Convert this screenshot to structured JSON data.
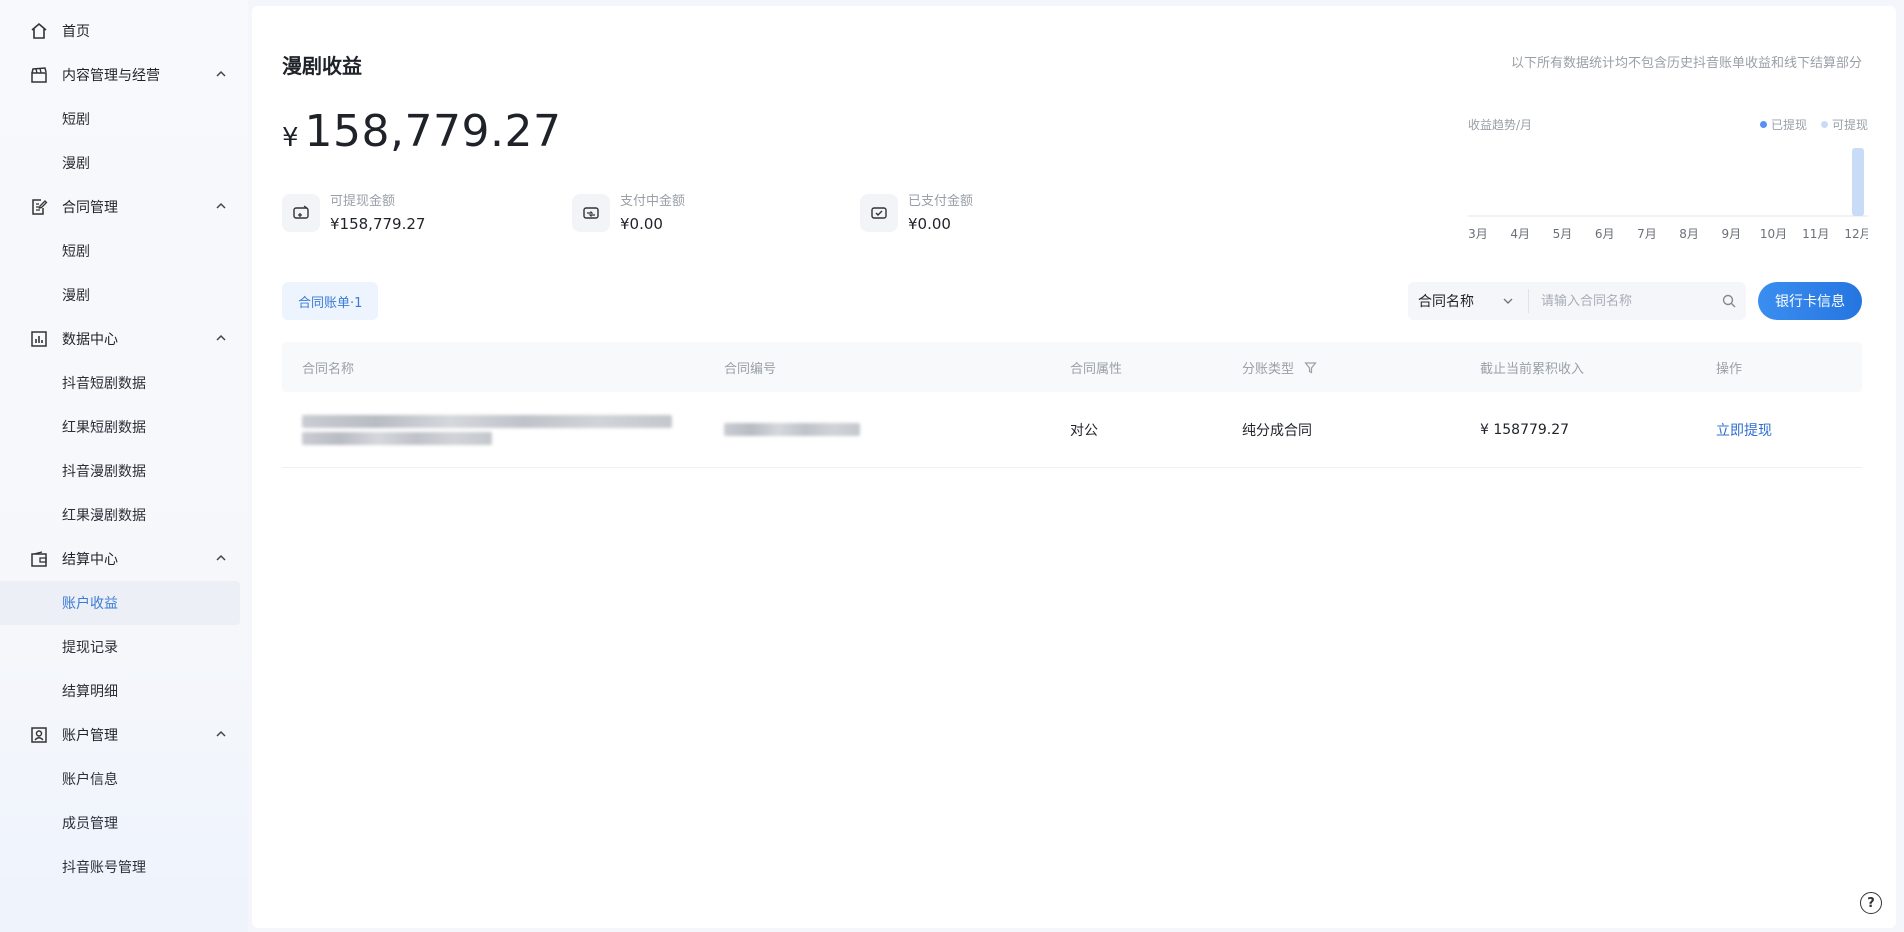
{
  "sidebar": {
    "home_label": "首页",
    "groups": [
      {
        "label": "内容管理与经营",
        "items": [
          "短剧",
          "漫剧"
        ]
      },
      {
        "label": "合同管理",
        "items": [
          "短剧",
          "漫剧"
        ]
      },
      {
        "label": "数据中心",
        "items": [
          "抖音短剧数据",
          "红果短剧数据",
          "抖音漫剧数据",
          "红果漫剧数据"
        ]
      },
      {
        "label": "结算中心",
        "items": [
          "账户收益",
          "提现记录",
          "结算明细"
        ]
      },
      {
        "label": "账户管理",
        "items": [
          "账户信息",
          "成员管理",
          "抖音账号管理"
        ]
      }
    ],
    "active_item": "账户收益"
  },
  "header": {
    "title": "漫剧收益",
    "note": "以下所有数据统计均不包含历史抖音账单收益和线下结算部分"
  },
  "summary": {
    "currency": "¥",
    "total": "158,779.27",
    "stats": [
      {
        "label": "可提现金额",
        "value": "¥158,779.27"
      },
      {
        "label": "支付中金额",
        "value": "¥0.00"
      },
      {
        "label": "已支付金额",
        "value": "¥0.00"
      }
    ]
  },
  "trend": {
    "title": "收益趋势/月",
    "legend": [
      {
        "name": "已提现",
        "color": "#5b8ff0"
      },
      {
        "name": "可提现",
        "color": "#c9dcf7"
      }
    ]
  },
  "chart_data": {
    "type": "bar",
    "categories": [
      "3月",
      "4月",
      "5月",
      "6月",
      "7月",
      "8月",
      "9月",
      "10月",
      "11月",
      "12月"
    ],
    "series": [
      {
        "name": "已提现",
        "values": [
          0,
          0,
          0,
          0,
          0,
          0,
          0,
          0,
          0,
          0
        ]
      },
      {
        "name": "可提现",
        "values": [
          0,
          0,
          0,
          0,
          0,
          0,
          0,
          0,
          0,
          158779.27
        ]
      }
    ],
    "title": "收益趋势/月",
    "grid": false,
    "legend_position": "top-right"
  },
  "toolbar": {
    "tab_label": "合同账单·1",
    "filter_select": "合同名称",
    "search_placeholder": "请输入合同名称",
    "bank_button": "银行卡信息"
  },
  "table": {
    "columns": [
      "合同名称",
      "合同编号",
      "合同属性",
      "分账类型",
      "截止当前累积收入",
      "操作"
    ],
    "rows": [
      {
        "attribute": "对公",
        "split_type": "纯分成合同",
        "income": "¥ 158779.27",
        "action": "立即提现"
      }
    ]
  },
  "help": {
    "label": "?"
  }
}
